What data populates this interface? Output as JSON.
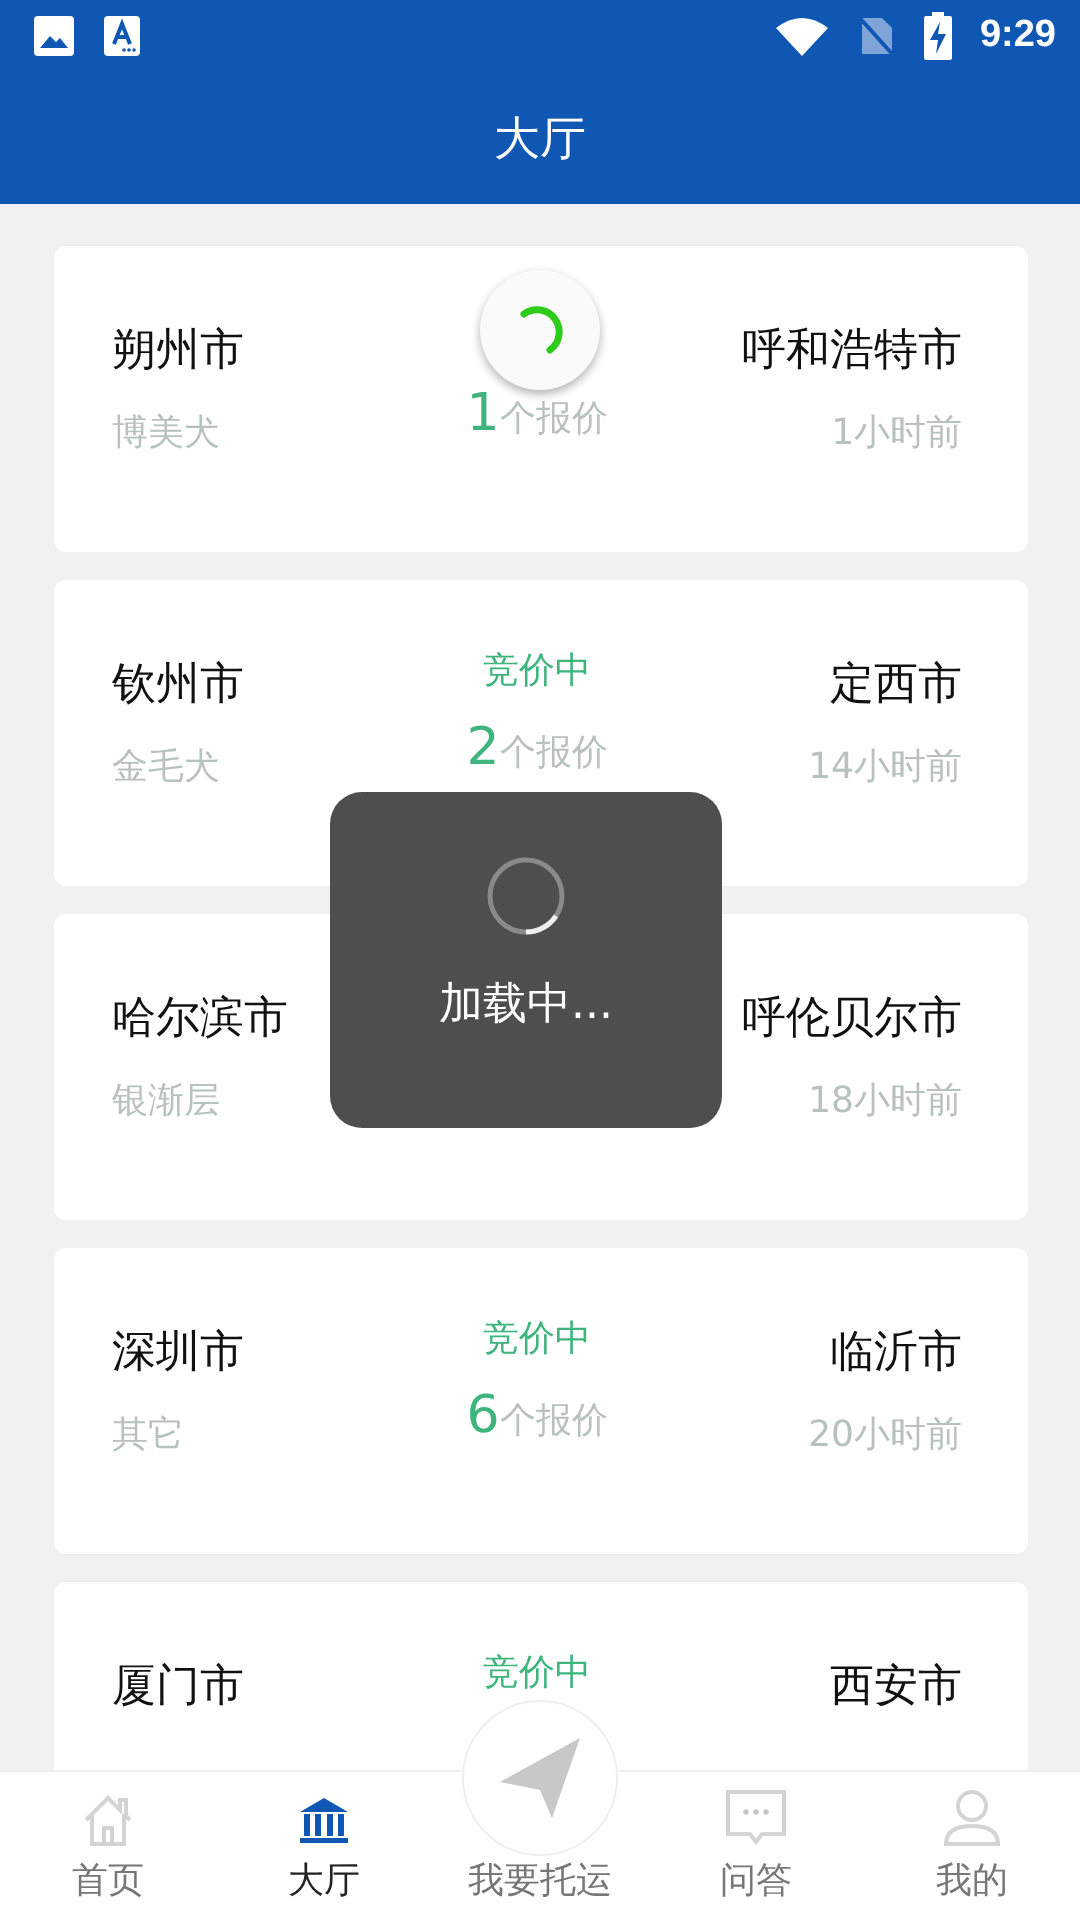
{
  "status_bar": {
    "time": "9:29"
  },
  "header": {
    "title": "大厅"
  },
  "cards": [
    {
      "from": "朔州市",
      "to": "呼和浩特市",
      "breed": "博美犬",
      "count": "1",
      "unit": "个报价",
      "time": "1小时前"
    },
    {
      "from": "钦州市",
      "to": "定西市",
      "status": "竞价中",
      "breed": "金毛犬",
      "count": "2",
      "unit": "个报价",
      "time": "14小时前"
    },
    {
      "from": "哈尔滨市",
      "to": "呼伦贝尔市",
      "breed": "银渐层",
      "time": "18小时前"
    },
    {
      "from": "深圳市",
      "to": "临沂市",
      "status": "竞价中",
      "breed": "其它",
      "count": "6",
      "unit": "个报价",
      "time": "20小时前"
    },
    {
      "from": "厦门市",
      "to": "西安市",
      "status": "竞价中"
    }
  ],
  "loading": {
    "text": "加载中..."
  },
  "nav": [
    {
      "label": "首页",
      "kind": "home",
      "selected": false
    },
    {
      "label": "大厅",
      "kind": "hall",
      "selected": true
    },
    {
      "label": "我要托运",
      "kind": "send",
      "selected": false
    },
    {
      "label": "问答",
      "kind": "chat",
      "selected": false
    },
    {
      "label": "我的",
      "kind": "user",
      "selected": false
    }
  ]
}
